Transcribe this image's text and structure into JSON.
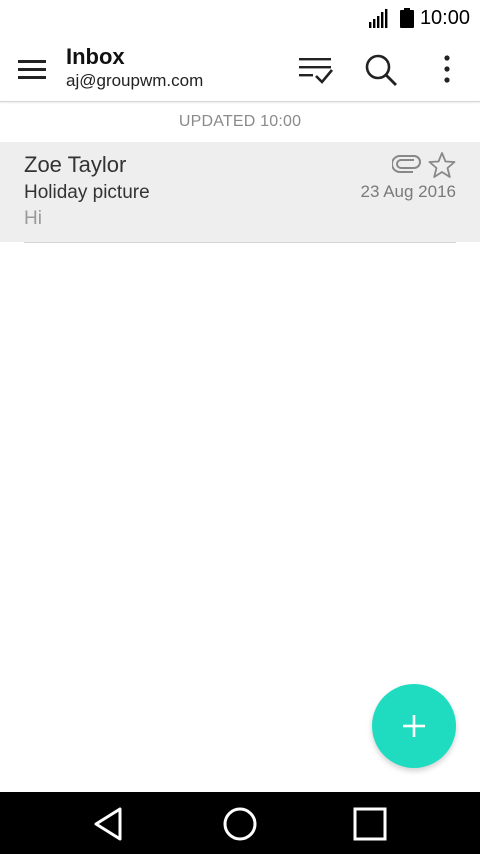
{
  "status_bar": {
    "time": "10:00",
    "icons": [
      "signal-icon",
      "battery-icon"
    ]
  },
  "app_bar": {
    "title": "Inbox",
    "account": "aj@groupwm.com",
    "icons": [
      "menu-icon",
      "select-list-icon",
      "search-icon",
      "more-vert-icon"
    ]
  },
  "list_header": {
    "updated_label": "UPDATED 10:00"
  },
  "messages": [
    {
      "sender": "Zoe Taylor",
      "subject": "Holiday picture",
      "preview": "Hi",
      "date": "23 Aug 2016",
      "has_attachment": true,
      "starred": false
    }
  ],
  "fab": {
    "icon": "plus-icon",
    "color": "#1fdcc0"
  },
  "nav_bar": {
    "icons": [
      "back-icon",
      "home-icon",
      "recents-icon"
    ]
  },
  "colors": {
    "accent": "#1fdcc0",
    "row_background": "#eeeeee",
    "nav_background": "#000000"
  }
}
